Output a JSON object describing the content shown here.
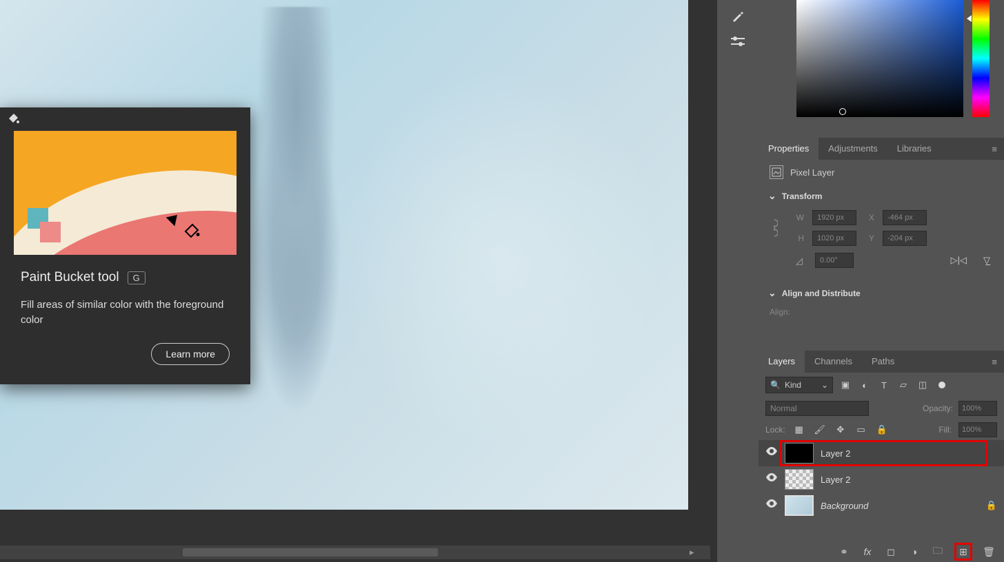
{
  "tooltip": {
    "title": "Paint Bucket tool",
    "shortcut": "G",
    "description": "Fill areas of similar color with the foreground color",
    "learn_more": "Learn more"
  },
  "panels": {
    "properties_tabs": [
      "Properties",
      "Adjustments",
      "Libraries"
    ],
    "properties_active": 0,
    "pixel_layer_label": "Pixel Layer",
    "transform": {
      "header": "Transform",
      "w_label": "W",
      "w_value": "1920 px",
      "h_label": "H",
      "h_value": "1020 px",
      "x_label": "X",
      "x_value": "-464 px",
      "y_label": "Y",
      "y_value": "-204 px",
      "angle": "0.00°"
    },
    "align_header": "Align and Distribute",
    "align_label": "Align:",
    "layer_tabs": [
      "Layers",
      "Channels",
      "Paths"
    ],
    "layer_tabs_active": 0,
    "kind_label": "Kind",
    "blend_mode": "Normal",
    "opacity_label": "Opacity:",
    "opacity_value": "100%",
    "lock_label": "Lock:",
    "fill_label": "Fill:",
    "fill_value": "100%",
    "layers": [
      {
        "name": "Layer 2",
        "thumb": "black",
        "selected": true,
        "locked": false,
        "italic": false
      },
      {
        "name": "Layer 2",
        "thumb": "check",
        "selected": false,
        "locked": false,
        "italic": false
      },
      {
        "name": "Background",
        "thumb": "img",
        "selected": false,
        "locked": true,
        "italic": true
      }
    ]
  }
}
